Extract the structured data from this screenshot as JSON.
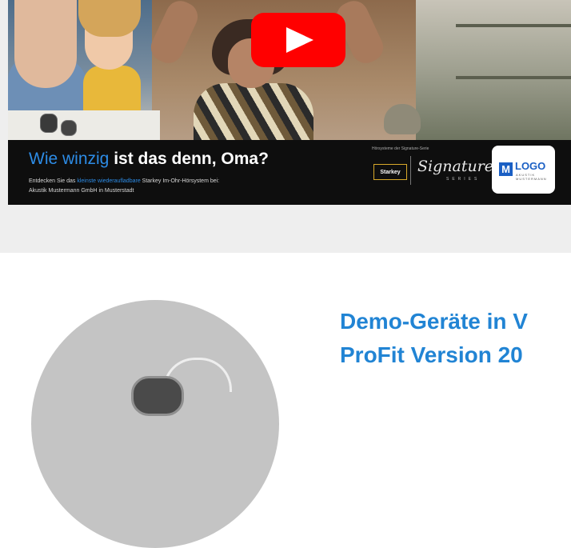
{
  "video": {
    "banner_title_highlight": "Wie winzig",
    "banner_title_rest": " ist das denn, Oma?",
    "desc_line1_a": "Entdecken Sie das ",
    "desc_line1_highlight": "kleinste wiederaufladbare",
    "desc_line1_b": " Starkey Im-Ohr-Hörsystem bei:",
    "desc_line2": "Akustik Mustermann GmbH in Musterstadt",
    "signature_tagline": "Hörsysteme der Signature-Serie",
    "starkey_label": "Starkey",
    "signature_label": "Signature",
    "series_label": "SERIES",
    "logo_letter": "M",
    "logo_text": "LOGO",
    "logo_sub": "AKUSTIK MUSTERMANN",
    "play_icon": "youtube-play-icon",
    "colors": {
      "play": "#ff0000",
      "highlight": "#2d8ce6",
      "heading": "#2184d4"
    }
  },
  "article": {
    "heading_line1": "Demo-Geräte in V",
    "heading_line2": "ProFit Version 20"
  }
}
